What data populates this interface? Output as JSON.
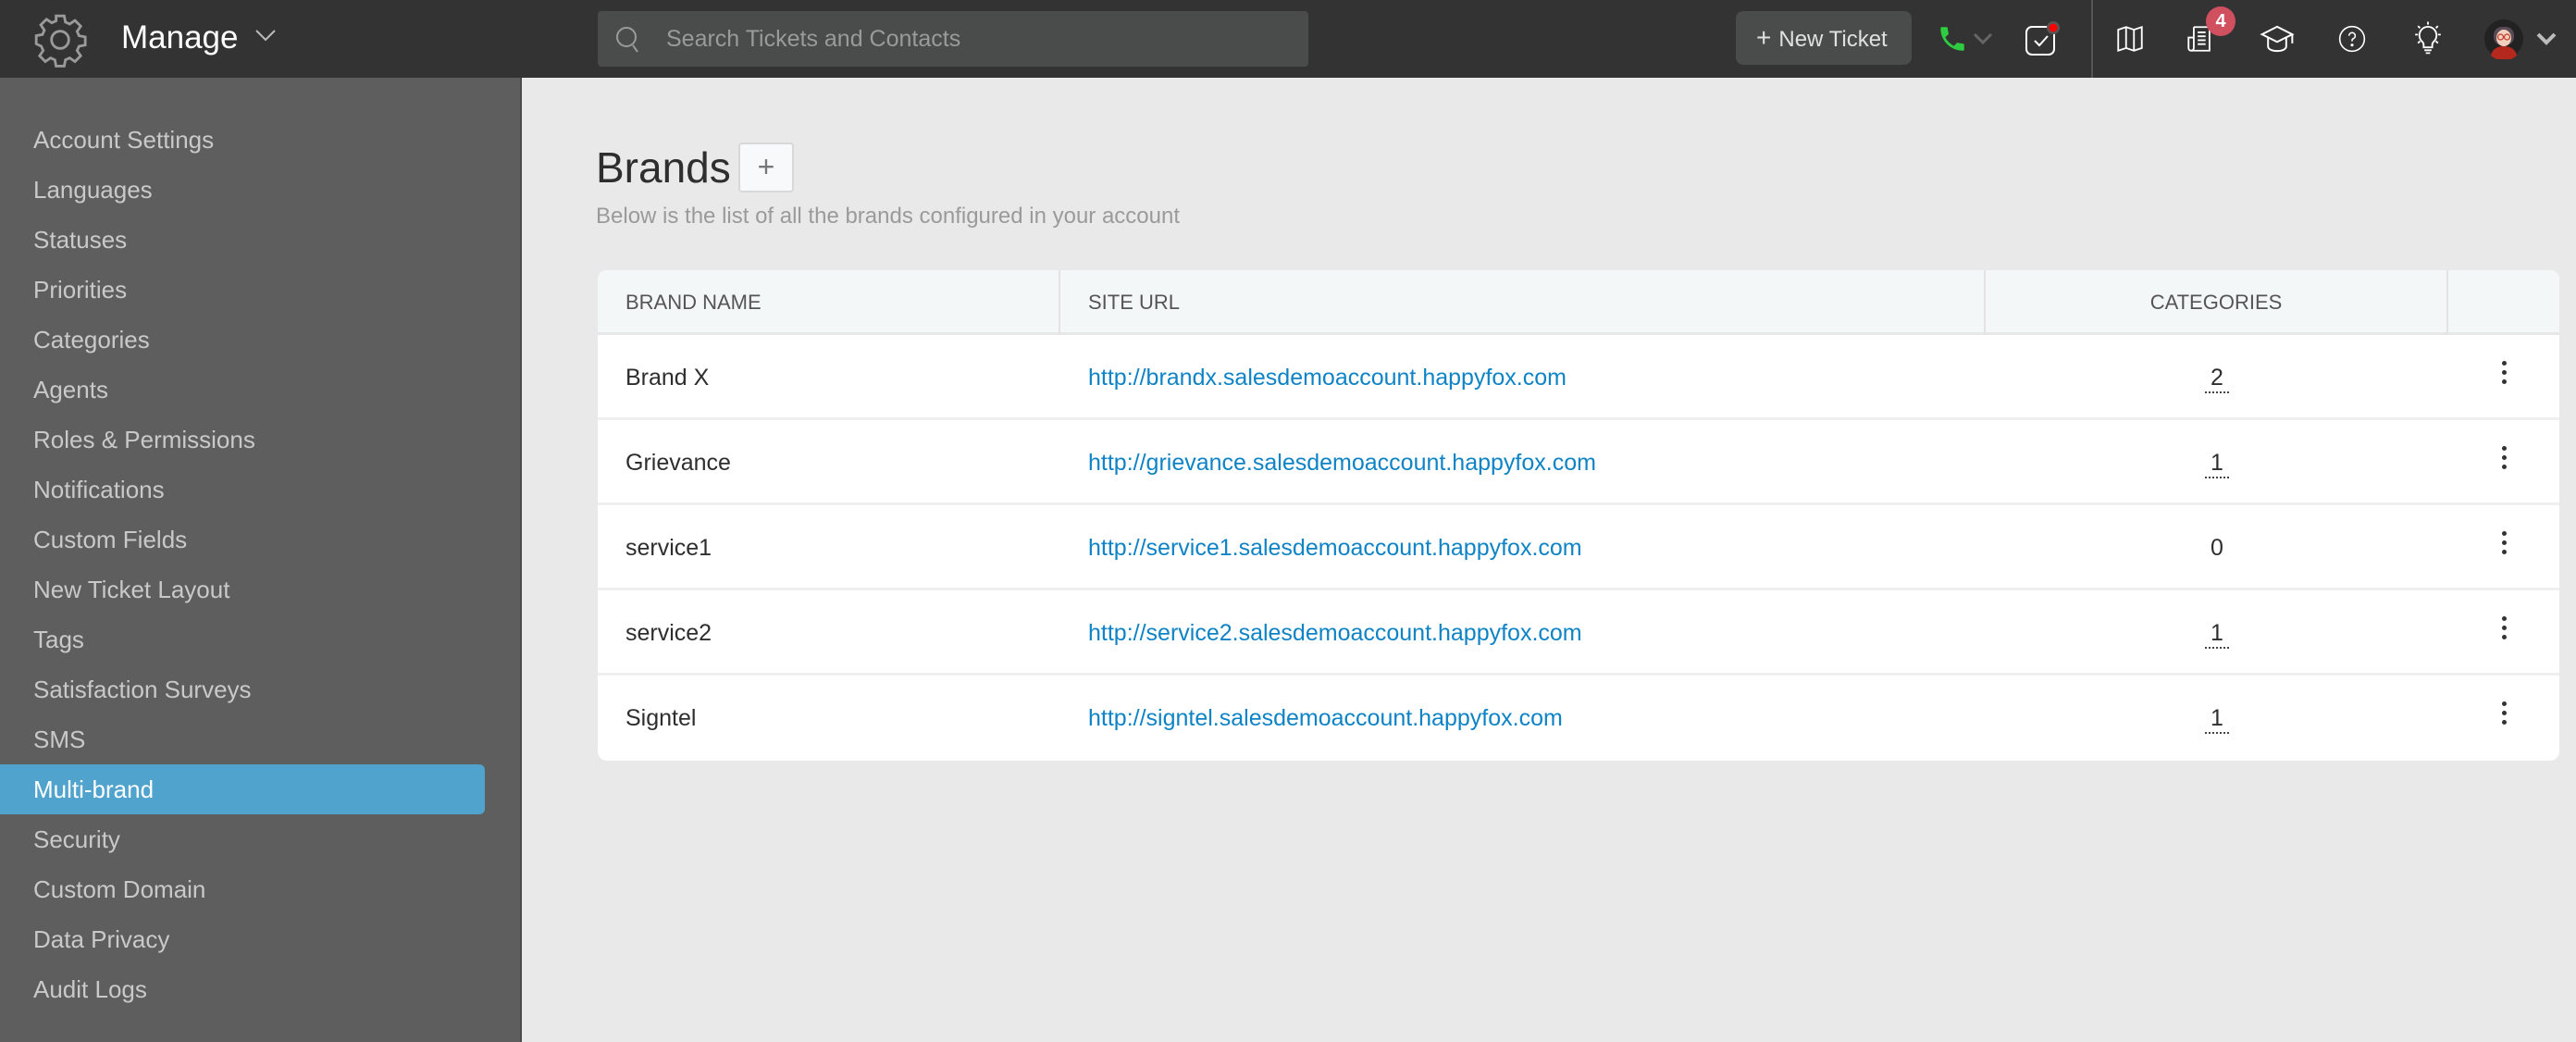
{
  "header": {
    "section_title": "Manage",
    "search_placeholder": "Search Tickets and Contacts",
    "new_ticket_label": "New Ticket",
    "notification_count": "4",
    "icons": [
      "gear-icon",
      "chevron-down-icon",
      "search-icon",
      "phone-icon",
      "tasks-icon",
      "map-icon",
      "news-icon",
      "learning-cap-icon",
      "help-icon",
      "bulb-icon",
      "avatar",
      "chevron-down-icon"
    ]
  },
  "sidebar": {
    "items": [
      {
        "label": "Account Settings",
        "active": false
      },
      {
        "label": "Languages",
        "active": false
      },
      {
        "label": "Statuses",
        "active": false
      },
      {
        "label": "Priorities",
        "active": false
      },
      {
        "label": "Categories",
        "active": false
      },
      {
        "label": "Agents",
        "active": false
      },
      {
        "label": "Roles & Permissions",
        "active": false
      },
      {
        "label": "Notifications",
        "active": false
      },
      {
        "label": "Custom Fields",
        "active": false
      },
      {
        "label": "New Ticket Layout",
        "active": false
      },
      {
        "label": "Tags",
        "active": false
      },
      {
        "label": "Satisfaction Surveys",
        "active": false
      },
      {
        "label": "SMS",
        "active": false
      },
      {
        "label": "Multi-brand",
        "active": true
      },
      {
        "label": "Security",
        "active": false
      },
      {
        "label": "Custom Domain",
        "active": false
      },
      {
        "label": "Data Privacy",
        "active": false
      },
      {
        "label": "Audit Logs",
        "active": false
      }
    ]
  },
  "main": {
    "title": "Brands",
    "add_label": "+",
    "subtitle": "Below is the list of all the brands configured in your account",
    "table": {
      "columns": [
        "BRAND NAME",
        "SITE URL",
        "CATEGORIES",
        ""
      ],
      "rows": [
        {
          "name": "Brand X",
          "url": "http://brandx.salesdemoaccount.happyfox.com",
          "categories": "2"
        },
        {
          "name": "Grievance",
          "url": "http://grievance.salesdemoaccount.happyfox.com",
          "categories": "1"
        },
        {
          "name": "service1",
          "url": "http://service1.salesdemoaccount.happyfox.com",
          "categories": "0"
        },
        {
          "name": "service2",
          "url": "http://service2.salesdemoaccount.happyfox.com",
          "categories": "1"
        },
        {
          "name": "Signtel",
          "url": "http://signtel.salesdemoaccount.happyfox.com",
          "categories": "1"
        }
      ]
    }
  },
  "colors": {
    "header_bg": "#333333",
    "sidebar_bg": "#5e5e5e",
    "active_item": "#4fa3cd",
    "link": "#0e83c5",
    "badge": "#d0505f",
    "phone_green": "#2ecc40"
  }
}
